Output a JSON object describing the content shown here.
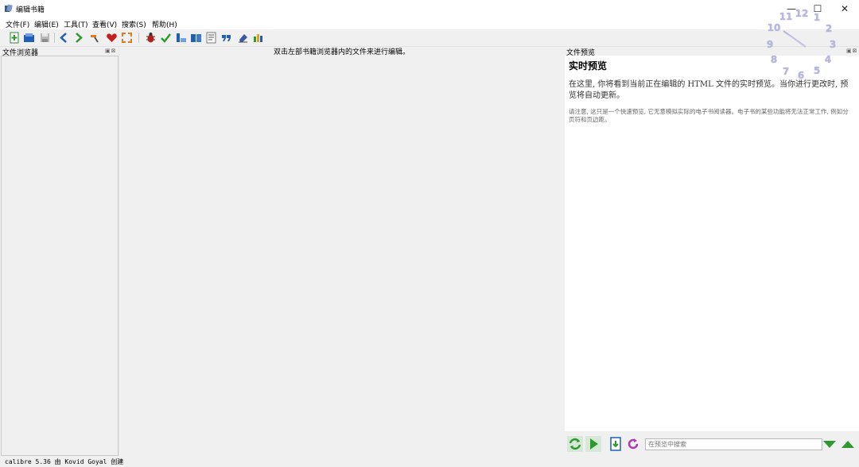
{
  "window": {
    "title": "编辑书籍",
    "min_glyph": "—",
    "max_glyph": "☐",
    "close_glyph": "✕"
  },
  "menu": {
    "items": [
      "文件(F)",
      "编辑(E)",
      "工具(T)",
      "查看(V)",
      "搜索(S)",
      "帮助(H)"
    ]
  },
  "toolbar": {
    "icons": [
      "new-file-icon",
      "open-book-icon",
      "save-icon",
      "back-arrow-icon",
      "forward-arrow-icon",
      "hammer-icon",
      "heart-icon",
      "fullscreen-icon",
      "bug-icon",
      "spellcheck-icon",
      "reports-icon",
      "book-icon",
      "toc-icon",
      "quote-icon",
      "eraser-icon",
      "stats-icon"
    ]
  },
  "file_browser": {
    "title": "文件浏览器",
    "dock_controls": "▣⊠"
  },
  "editor": {
    "hint": "双击左部书籍浏览器内的文件来进行编辑。"
  },
  "preview": {
    "title": "文件预览",
    "dock_controls": "▣⊠",
    "heading": "实时预览",
    "para1": "在这里, 你将看到当前正在编辑的 HTML 文件的实时预览。当你进行更改时, 预览将自动更新。",
    "para2": "请注意, 这只是一个快速预览, 它无意模拟实际的电子书阅读器。电子书的某些功能将无法正常工作, 例如分页符和页边距。",
    "search_placeholder": "在预览中搜索"
  },
  "clock": {
    "numbers": [
      "12",
      "1",
      "2",
      "3",
      "4",
      "5",
      "6",
      "7",
      "8",
      "9",
      "10",
      "11"
    ]
  },
  "status": {
    "text": "calibre 5.36 由 Kovid Goyal 创建"
  },
  "colors": {
    "accent_green": "#2e9a2e",
    "accent_blue": "#1f5fb6",
    "clock_purple": "#b7b7dd"
  }
}
